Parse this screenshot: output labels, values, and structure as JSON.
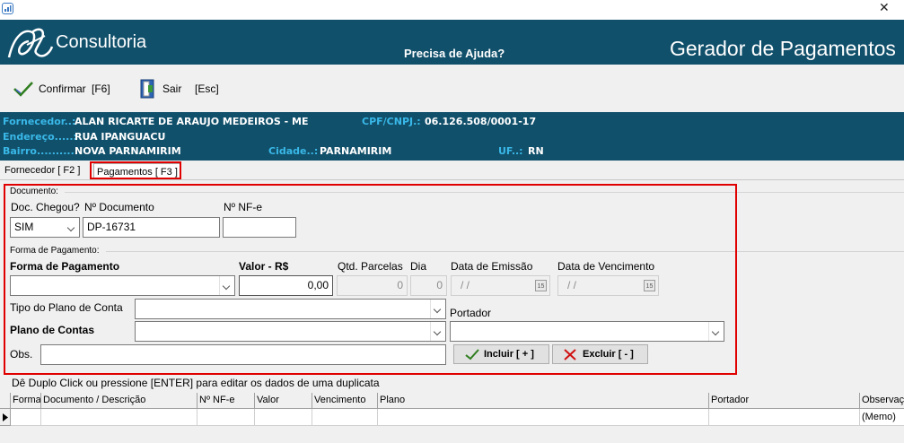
{
  "titlebar": {
    "close_glyph": "✕",
    "icon": "chart-app-icon"
  },
  "banner": {
    "brand": "Consultoria",
    "help": "Precisa de Ajuda?",
    "form_title": "Gerador de Pagamentos"
  },
  "toolbar": {
    "confirm_label": "Confirmar",
    "confirm_key": "[F6]",
    "exit_label": "Sair",
    "exit_key": "[Esc]"
  },
  "supplier": {
    "fornecedor_label": "Fornecedor..:",
    "fornecedor_value": "ALAN RICARTE DE ARAUJO MEDEIROS - ME",
    "cpf_label": "CPF/CNPJ.:",
    "cpf_value": "06.126.508/0001-17",
    "endereco_label": "Endereço.....:",
    "endereco_value": "RUA IPANGUACU",
    "bairro_label": "Bairro..........:",
    "bairro_value": "NOVA PARNAMIRIM",
    "cidade_label": "Cidade..:",
    "cidade_value": "PARNAMIRIM",
    "uf_label": "UF..:",
    "uf_value": "RN"
  },
  "tabs": [
    {
      "label": "Fornecedor [ F2 ]"
    },
    {
      "label": "Pagamentos [ F3 ]"
    }
  ],
  "documento": {
    "group_label": "Documento:",
    "doc_chegou_label": "Doc. Chegou?",
    "doc_chegou_value": "SIM",
    "numero_label": "Nº Documento",
    "numero_value": "DP-16731",
    "nfe_label": "Nº NF-e",
    "nfe_value": ""
  },
  "pagamento": {
    "group_label": "Forma de Pagamento:",
    "forma_label": "Forma de Pagamento",
    "forma_value": "",
    "valor_label": "Valor - R$",
    "valor_value": "0,00",
    "qtd_label": "Qtd. Parcelas",
    "qtd_value": "0",
    "dia_label": "Dia",
    "dia_value": "0",
    "emissao_label": "Data de Emissão",
    "emissao_value": "/ /",
    "vencimento_label": "Data de Vencimento",
    "vencimento_value": "/ /",
    "calendar_glyph": "15",
    "tipo_plano_label": "Tipo do Plano de Conta",
    "plano_label": "Plano de Contas",
    "portador_label": "Portador",
    "obs_label": "Obs.",
    "incluir_label": "Incluir [ + ]",
    "excluir_label": "Excluir [ - ]"
  },
  "grid": {
    "hint": "Dê Duplo Click ou pressione [ENTER] para editar os dados de uma duplicata",
    "columns": [
      "Forma",
      "Documento / Descrição",
      "Nº NF-e",
      "Valor",
      "Vencimento",
      "Plano",
      "Portador",
      "Observação"
    ],
    "row": {
      "observacao": "(Memo)"
    }
  },
  "colors": {
    "banner": "#11506b",
    "label_cyan": "#39b8e8",
    "highlight_red": "#e00000"
  }
}
